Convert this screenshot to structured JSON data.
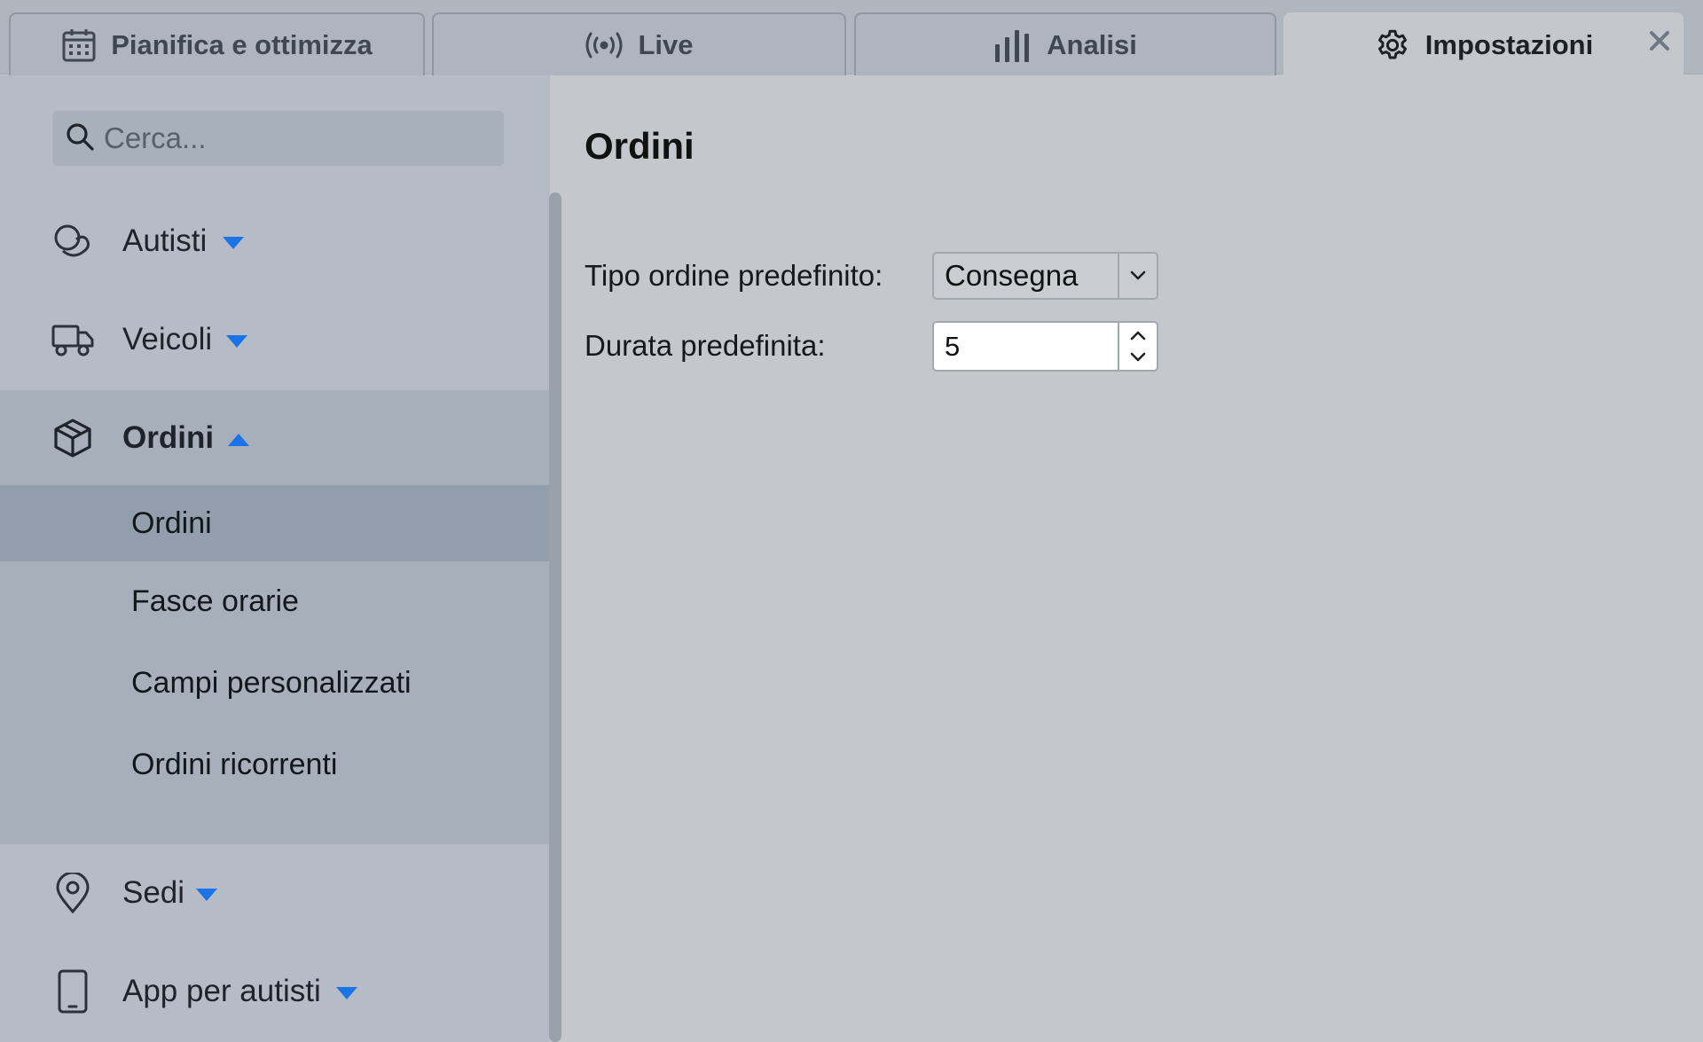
{
  "tabs": [
    {
      "label": "Pianifica e ottimizza",
      "icon": "calendar-icon",
      "active": false
    },
    {
      "label": "Live",
      "icon": "broadcast-icon",
      "active": false
    },
    {
      "label": "Analisi",
      "icon": "bar-chart-icon",
      "active": false
    },
    {
      "label": "Impostazioni",
      "icon": "gear-icon",
      "active": true
    }
  ],
  "search": {
    "placeholder": "Cerca..."
  },
  "sidebar": {
    "items": [
      {
        "label": "Autisti",
        "icon": "drivers-icon",
        "expanded": false
      },
      {
        "label": "Veicoli",
        "icon": "truck-icon",
        "expanded": false
      },
      {
        "label": "Ordini",
        "icon": "package-icon",
        "expanded": true
      },
      {
        "label": "Sedi",
        "icon": "map-pin-icon",
        "expanded": false
      },
      {
        "label": "App per autisti",
        "icon": "smartphone-icon",
        "expanded": false
      }
    ],
    "subitems": [
      {
        "label": "Ordini",
        "selected": true
      },
      {
        "label": "Fasce orarie",
        "selected": false
      },
      {
        "label": "Campi personalizzati",
        "selected": false
      },
      {
        "label": "Ordini ricorrenti",
        "selected": false
      }
    ]
  },
  "main": {
    "title": "Ordini",
    "fields": {
      "order_type": {
        "label": "Tipo ordine predefinito:",
        "value": "Consegna"
      },
      "duration": {
        "label": "Durata predefinita:",
        "value": "5"
      }
    }
  },
  "colors": {
    "accent": "#1a73e8",
    "icon": "#2b323a"
  }
}
